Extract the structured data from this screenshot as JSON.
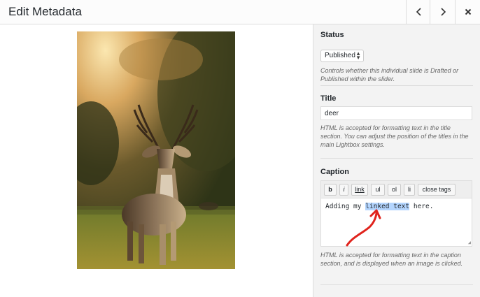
{
  "header": {
    "title": "Edit Metadata"
  },
  "status": {
    "label": "Status",
    "selected": "Published",
    "description": "Controls whether this individual slide is Drafted or Published within the slider."
  },
  "title_field": {
    "label": "Title",
    "value": "deer",
    "description": "HTML is accepted for formatting text in the title section. You can adjust the position of the titles in the main Lightbox settings."
  },
  "caption": {
    "label": "Caption",
    "toolbar": {
      "bold": "b",
      "italic": "i",
      "link": "link",
      "ul": "ul",
      "ol": "ol",
      "li": "li",
      "close_tags": "close tags"
    },
    "text_before": "Adding my ",
    "text_selected": "linked text",
    "text_after": " here.",
    "description": "HTML is accepted for formatting text in the caption section, and is displayed when an image is clicked."
  },
  "colors": {
    "selection": "#b4d5fe",
    "annotation_arrow": "#e0231c"
  }
}
